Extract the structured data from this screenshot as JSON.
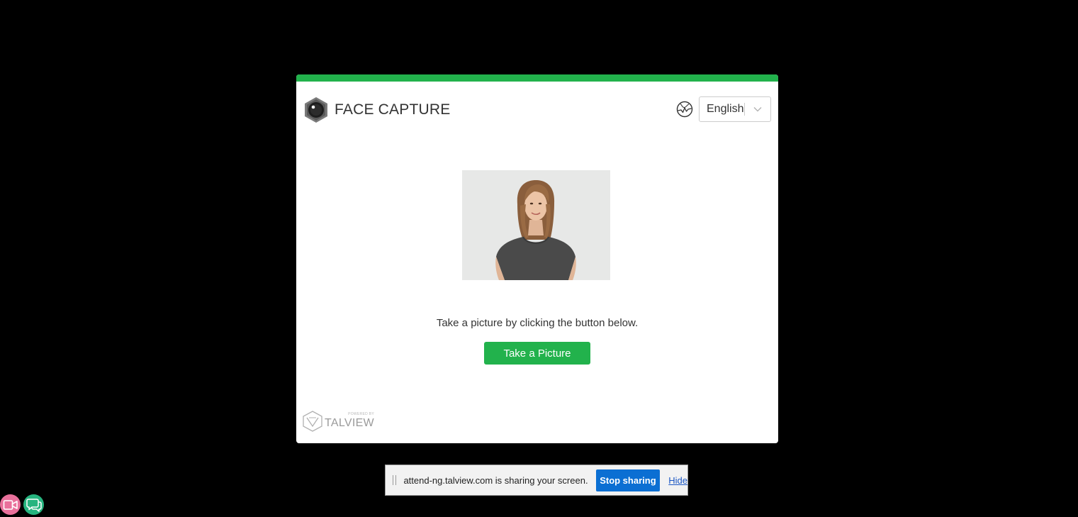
{
  "modal": {
    "title": "FACE CAPTURE",
    "accent_color": "#22b24c",
    "language": {
      "icon": "globe-icon",
      "selected": "English"
    },
    "photo_description": "",
    "instruction": "Take a picture by clicking the button below.",
    "take_picture_label": "Take a Picture",
    "footer": {
      "powered_by": "POWERED BY",
      "brand": "TALVIEW"
    }
  },
  "screen_share_bar": {
    "message": "attend-ng.talview.com is sharing your screen.",
    "stop_label": "Stop sharing",
    "hide_label": "Hide",
    "stop_color": "#0b6fd3"
  },
  "floating_buttons": {
    "video_icon": "video-camera-icon",
    "video_color": "#e9709b",
    "chat_icon": "chat-bubbles-icon",
    "chat_color": "#26b47f"
  }
}
